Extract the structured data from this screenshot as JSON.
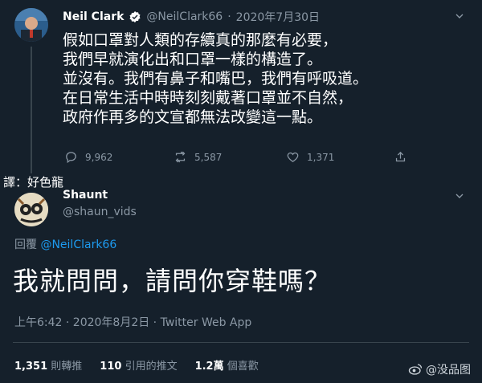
{
  "first_tweet": {
    "name": "Neil Clark",
    "handle": "@NeilClark66",
    "separator": "·",
    "date": "2020年7月30日",
    "text": "假如口罩對人類的存續真的那麼有必要，\n我們早就演化出和口罩一樣的構造了。\n並沒有。我們有鼻子和嘴巴，我們有呼吸道。\n在日常生活中時時刻刻戴著口罩並不自然，\n政府作再多的文宣都無法改變這一點。",
    "actions": [
      {
        "icon": "reply-icon",
        "count": "9,962"
      },
      {
        "icon": "retweet-icon",
        "count": "5,587"
      },
      {
        "icon": "like-icon",
        "count": "1,371"
      },
      {
        "icon": "share-icon",
        "count": ""
      }
    ]
  },
  "translator_note": "譯：好色龍",
  "reply_tweet": {
    "name": "Shaunt",
    "handle": "@shaun_vids",
    "replying_prefix": "回覆",
    "replying_to": "@NeilClark66",
    "text": "我就問問，請問你穿鞋嗎？",
    "timestamp": "上午6:42 · 2020年8月2日 · Twitter Web App",
    "stats": [
      {
        "value": "1,351",
        "label": "則轉推"
      },
      {
        "value": "110",
        "label": "引用的推文"
      },
      {
        "value": "1.2萬",
        "label": "個喜歡"
      }
    ]
  },
  "watermark": "@没品图",
  "colors": {
    "background": "#15202b",
    "muted": "#8b98a5",
    "link": "#1d9bf0",
    "divider": "#38444d"
  }
}
